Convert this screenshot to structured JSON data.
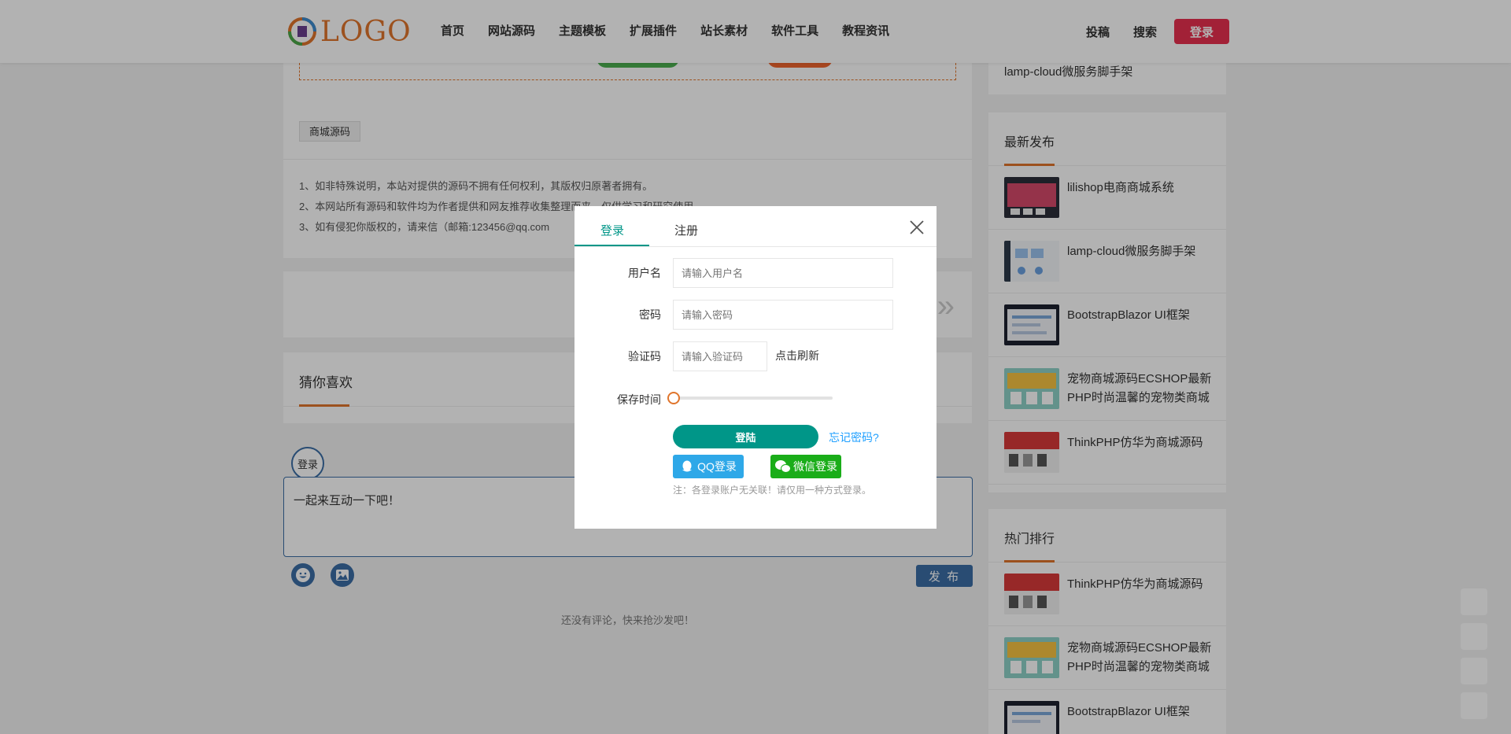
{
  "header": {
    "logo_text": "LOGO",
    "nav": [
      "首页",
      "网站源码",
      "主题模板",
      "扩展插件",
      "站长素材",
      "软件工具",
      "教程资讯"
    ],
    "contribute": "投稿",
    "search": "搜索",
    "login": "登录"
  },
  "article": {
    "tag": "商城源码",
    "notes": [
      "1、如非特殊说明，本站对提供的源码不拥有任何权利，其版权归原著者拥有。",
      "2、本网站所有源码和软件均为作者提供和网友推荐收集整理而来，仅供学习和研究使用。",
      "3、如有侵犯你版权的，请来信（邮箱:123456@qq.com"
    ],
    "next_arrow": "»"
  },
  "guess": {
    "title": "猜你喜欢"
  },
  "comment": {
    "avatar_label": "登录",
    "placeholder": "一起来互动一下吧！",
    "post_label": "发 布",
    "empty_text": "还没有评论，快来抢沙发吧！"
  },
  "sidebar": {
    "top_item": "lamp-cloud微服务脚手架",
    "latest": {
      "title": "最新发布",
      "items": [
        "lilishop电商商城系统",
        "lamp-cloud微服务脚手架",
        "BootstrapBlazor UI框架",
        "宠物商城源码ECSHOP最新PHP时尚温馨的宠物类商城",
        "ThinkPHP仿华为商城源码"
      ]
    },
    "hot": {
      "title": "热门排行",
      "items": [
        "ThinkPHP仿华为商城源码",
        "宠物商城源码ECSHOP最新PHP时尚温馨的宠物类商城",
        "BootstrapBlazor UI框架"
      ]
    }
  },
  "modal": {
    "tab_login": "登录",
    "tab_register": "注册",
    "username_label": "用户名",
    "username_placeholder": "请输入用户名",
    "password_label": "密码",
    "password_placeholder": "请输入密码",
    "captcha_label": "验证码",
    "captcha_placeholder": "请输入验证码",
    "refresh_text": "点击刷新",
    "keep_label": "保存时间",
    "submit_label": "登陆",
    "forgot_label": "忘记密码?",
    "qq_label": "QQ登录",
    "wechat_label": "微信登录",
    "note": "注：各登录账户无关联！请仅用一种方式登录。",
    "keep_value": 0
  },
  "colors": {
    "accent": "#009688",
    "brand_orange": "#e0752c",
    "login_red": "#e9304f",
    "comment_blue": "#3b6ea5",
    "qq_blue": "#2ea8e8",
    "wechat_green": "#1aad19"
  }
}
